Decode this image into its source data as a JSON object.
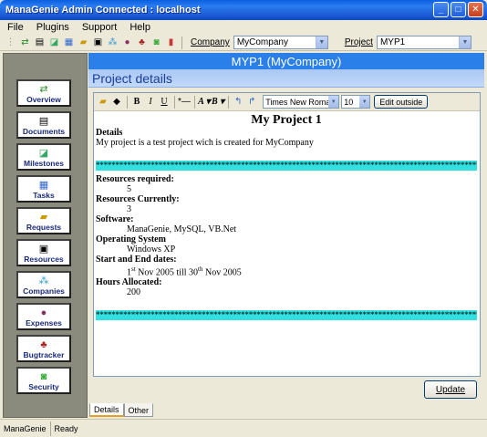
{
  "window": {
    "title": "ManaGenie Admin Connected : localhost"
  },
  "menu": [
    "File",
    "Plugins",
    "Support",
    "Help"
  ],
  "toolbar": {
    "company_label": "Company",
    "company_value": "MyCompany",
    "project_label": "Project",
    "project_value": "MYP1"
  },
  "sidebar": [
    {
      "label": "Overview",
      "icon": "overview-icon"
    },
    {
      "label": "Documents",
      "icon": "documents-icon"
    },
    {
      "label": "Milestones",
      "icon": "milestones-icon"
    },
    {
      "label": "Tasks",
      "icon": "tasks-icon"
    },
    {
      "label": "Requests",
      "icon": "requests-icon"
    },
    {
      "label": "Resources",
      "icon": "resources-icon"
    },
    {
      "label": "Companies",
      "icon": "companies-icon"
    },
    {
      "label": "Expenses",
      "icon": "expenses-icon"
    },
    {
      "label": "Bugtracker",
      "icon": "bugtracker-icon"
    },
    {
      "label": "Security",
      "icon": "security-icon"
    }
  ],
  "banner": "MYP1 (MyCompany)",
  "panel_title": "Project details",
  "editor": {
    "font": "Times New Roman",
    "size": "10",
    "edit_outside": "Edit outside"
  },
  "doc": {
    "title": "My Project 1",
    "details_heading": "Details",
    "details_text": "My project is a test project wich is created for MyCompany",
    "stars": "****************************************************************************************************************",
    "resources_required_label": "Resources required:",
    "resources_required": "5",
    "resources_currently_label": "Resources Currently:",
    "resources_currently": "3",
    "software_label": "Software:",
    "software": "ManaGenie, MySQL, VB.Net",
    "os_label": "Operating System",
    "os": "Windows XP",
    "dates_label": "Start and End dates:",
    "start_day": "1",
    "start_sup": "st",
    "start_rest": " Nov 2005 till 30",
    "end_sup": "th",
    "end_rest": " Nov 2005",
    "hours_label": "Hours Allocated:",
    "hours": "200"
  },
  "update_button": "Update",
  "tabs": [
    "Details",
    "Other"
  ],
  "status": {
    "app": "ManaGenie",
    "state": "Ready"
  },
  "colors": {
    "banner": "#2b7fe8",
    "highlight": "#33e0e0",
    "sidebar": "#8a8b7c"
  }
}
